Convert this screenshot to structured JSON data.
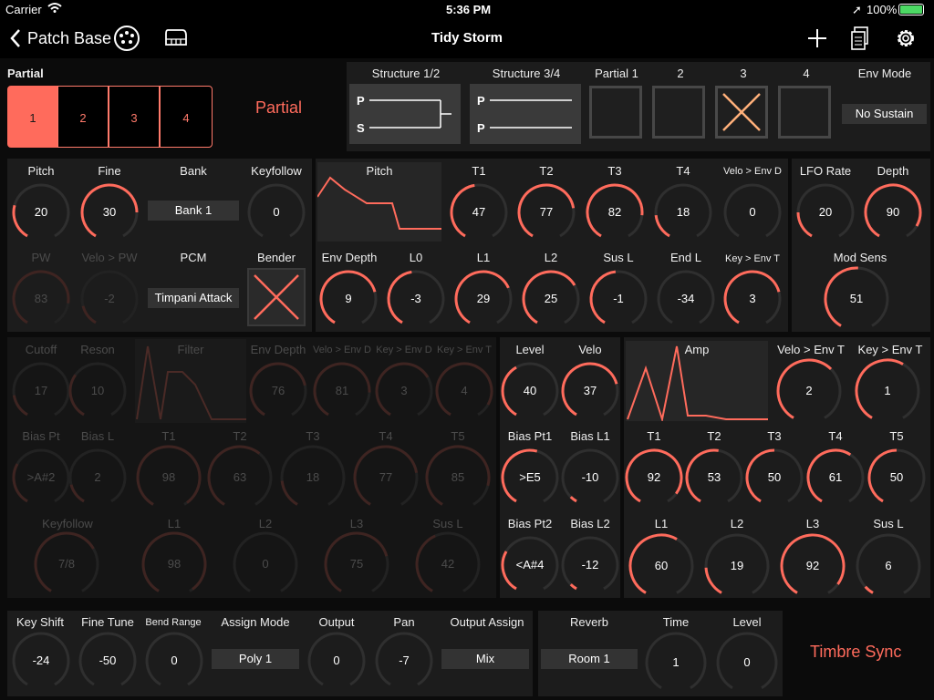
{
  "status": {
    "carrier": "Carrier",
    "time": "5:36 PM",
    "battery": "100%"
  },
  "nav": {
    "back": "Patch Base",
    "title": "Tidy Storm"
  },
  "partial_section": {
    "label": "Partial",
    "big_label": "Partial",
    "tabs": [
      "1",
      "2",
      "3",
      "4"
    ],
    "selected": 0
  },
  "structure": {
    "s12": "Structure 1/2",
    "s34": "Structure 3/4",
    "p1": "Partial 1",
    "p2": "2",
    "p3": "3",
    "p4": "4",
    "envmode_label": "Env Mode",
    "envmode": "No Sustain",
    "p_lbl": "P",
    "s_lbl": "S"
  },
  "wg": {
    "pitch_label": "Pitch",
    "pitch": "20",
    "fine_label": "Fine",
    "fine": "30",
    "bank_label": "Bank",
    "bank": "Bank 1",
    "keyfollow_label": "Keyfollow",
    "keyfollow": "0",
    "pw_label": "PW",
    "pw": "83",
    "velo_pw_label": "Velo > PW",
    "velo_pw": "-2",
    "pcm_label": "PCM",
    "pcm": "Timpani Attack",
    "bender_label": "Bender"
  },
  "penv": {
    "title": "Pitch",
    "t1_label": "T1",
    "t1": "47",
    "t2_label": "T2",
    "t2": "77",
    "t3_label": "T3",
    "t3": "82",
    "t4_label": "T4",
    "t4": "18",
    "velo_label": "Velo > Env D",
    "velo": "0",
    "depth_label": "Env Depth",
    "depth": "9",
    "l0_label": "L0",
    "l0": "-3",
    "l1_label": "L1",
    "l1": "29",
    "l2_label": "L2",
    "l2": "25",
    "susl_label": "Sus L",
    "susl": "-1",
    "endl_label": "End L",
    "endl": "-34",
    "key_label": "Key > Env T",
    "key": "3"
  },
  "lfo": {
    "rate_label": "LFO Rate",
    "rate": "20",
    "depth_label": "Depth",
    "depth": "90",
    "mod_label": "Mod Sens",
    "mod": "51"
  },
  "tvf": {
    "cutoff_label": "Cutoff",
    "cutoff": "17",
    "reson_label": "Reson",
    "reson": "10",
    "filter_label": "Filter",
    "envdepth_label": "Env Depth",
    "envdepth": "76",
    "velo_label": "Velo > Env D",
    "velo": "81",
    "key_envd_label": "Key > Env D",
    "key_envd": "3",
    "key_envt_label": "Key > Env T",
    "key_envt": "4",
    "biaspt_label": "Bias Pt",
    "biaspt": ">A#2",
    "biasl_label": "Bias L",
    "biasl": "2",
    "t1_label": "T1",
    "t1": "98",
    "t2_label": "T2",
    "t2": "63",
    "t3_label": "T3",
    "t3": "18",
    "t4_label": "T4",
    "t4": "77",
    "t5_label": "T5",
    "t5": "85",
    "keyfollow_label": "Keyfollow",
    "keyfollow": "7/8",
    "l1_label": "L1",
    "l1": "98",
    "l2_label": "L2",
    "l2": "0",
    "l3_label": "L3",
    "l3": "75",
    "susl_label": "Sus L",
    "susl": "42"
  },
  "tva": {
    "level_label": "Level",
    "level": "40",
    "velo_label": "Velo",
    "velo": "37",
    "biaspt1_label": "Bias Pt1",
    "biaspt1": ">E5",
    "biasl1_label": "Bias L1",
    "biasl1": "-10",
    "biaspt2_label": "Bias Pt2",
    "biaspt2": "<A#4",
    "biasl2_label": "Bias L2",
    "biasl2": "-12"
  },
  "aenv": {
    "title": "Amp",
    "velo_label": "Velo > Env T",
    "velo": "2",
    "key_label": "Key > Env T",
    "key": "1",
    "t1_label": "T1",
    "t1": "92",
    "t2_label": "T2",
    "t2": "53",
    "t3_label": "T3",
    "t3": "50",
    "t4_label": "T4",
    "t4": "61",
    "t5_label": "T5",
    "t5": "50",
    "l1_label": "L1",
    "l1": "60",
    "l2_label": "L2",
    "l2": "19",
    "l3_label": "L3",
    "l3": "92",
    "susl_label": "Sus L",
    "susl": "6"
  },
  "common": {
    "keyshift_label": "Key Shift",
    "keyshift": "-24",
    "finetune_label": "Fine Tune",
    "finetune": "-50",
    "bend_label": "Bend Range",
    "bend": "0",
    "assign_label": "Assign Mode",
    "assign": "Poly 1",
    "output_label": "Output",
    "output": "0",
    "pan_label": "Pan",
    "pan": "-7",
    "outassign_label": "Output Assign",
    "outassign": "Mix"
  },
  "reverb": {
    "reverb_label": "Reverb",
    "reverb": "Room 1",
    "time_label": "Time",
    "time": "1",
    "level_label": "Level",
    "level": "0"
  },
  "timbre_sync": "Timbre Sync",
  "colors": {
    "accent": "#ff6b5c",
    "panel": "#1c1c1c",
    "track": "#2f2f2f"
  }
}
